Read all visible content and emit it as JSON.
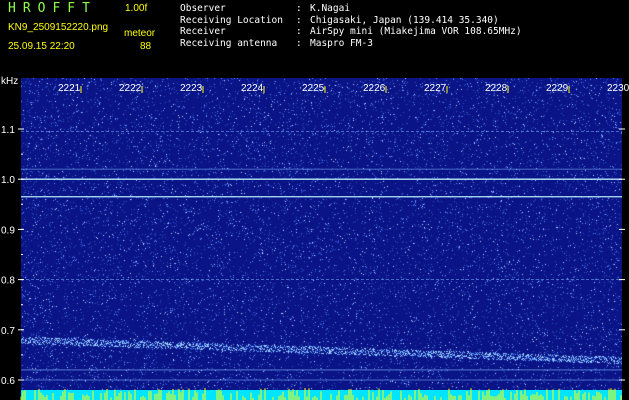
{
  "header": {
    "app_title": "HROFFT",
    "version": "1.00f",
    "filename": "KN9_2509152220.png",
    "mode": "meteor",
    "datetime": "25.09.15 22:20",
    "count": "88"
  },
  "info": {
    "rows": [
      {
        "key": "Observer",
        "sep": ":",
        "value": "K.Nagai"
      },
      {
        "key": "Receiving Location",
        "sep": ":",
        "value": "Chigasaki, Japan (139.414 35.340)"
      },
      {
        "key": "Receiver",
        "sep": ":",
        "value": "AirSpy mini (Miakejima VOR 108.65MHz)"
      },
      {
        "key": "Receiving antenna",
        "sep": ":",
        "value": "Maspro FM-3"
      }
    ]
  },
  "chart_data": {
    "type": "heatmap",
    "ylabel": "kHz",
    "ylim": [
      0.58,
      1.2
    ],
    "y_ticks": [
      "1.1",
      "1.0",
      "0.9",
      "0.8",
      "0.7",
      "0.6"
    ],
    "y_tick_values": [
      1.1,
      1.0,
      0.9,
      0.8,
      0.7,
      0.6
    ],
    "x_ticks": [
      "2221",
      "2222",
      "2223",
      "2224",
      "2225",
      "2226",
      "2227",
      "2228",
      "2229",
      "2230"
    ],
    "x_range": [
      "2220",
      "2230"
    ],
    "horizontal_lines_khz": [
      1.095,
      1.02,
      1.0,
      0.965,
      0.8,
      0.62,
      0.6
    ],
    "drift_line": {
      "start_khz": 0.68,
      "end_khz": 0.64
    },
    "colors": {
      "background": "#0a1486",
      "noise": "#5f8cff",
      "bright": "#bff6ff",
      "bottom_bar": "#00e5ff",
      "bottom_spikes": "#ffff00"
    }
  }
}
